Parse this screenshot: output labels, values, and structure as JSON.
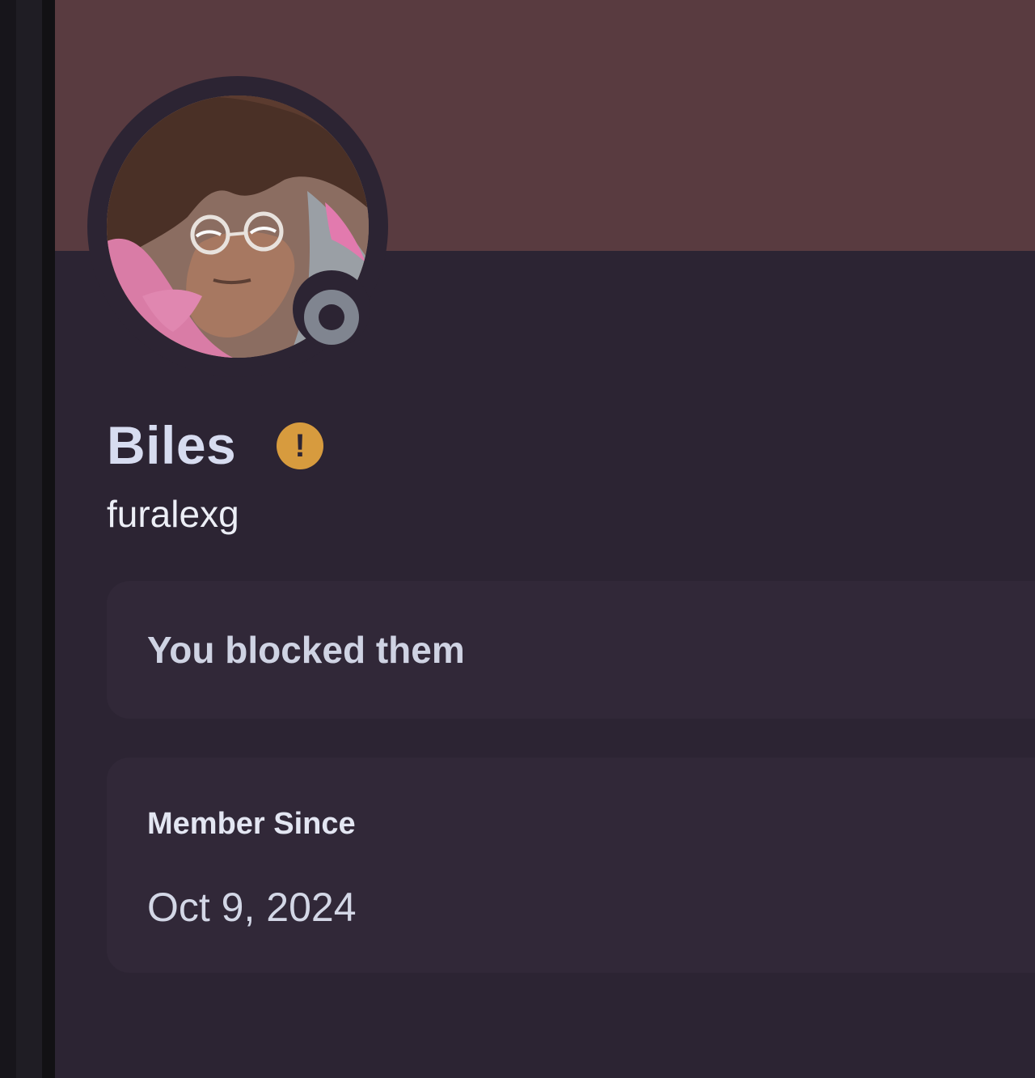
{
  "profile": {
    "display_name": "Biles",
    "username": "furalexg",
    "warning_badge_symbol": "!",
    "status": "offline",
    "avatar": "profile-avatar",
    "banner_color": "#593b40",
    "accent_warning_color": "#d79b3e"
  },
  "blocked_notice": {
    "text": "You blocked them"
  },
  "member_since": {
    "label": "Member Since",
    "date": "Oct 9, 2024"
  }
}
